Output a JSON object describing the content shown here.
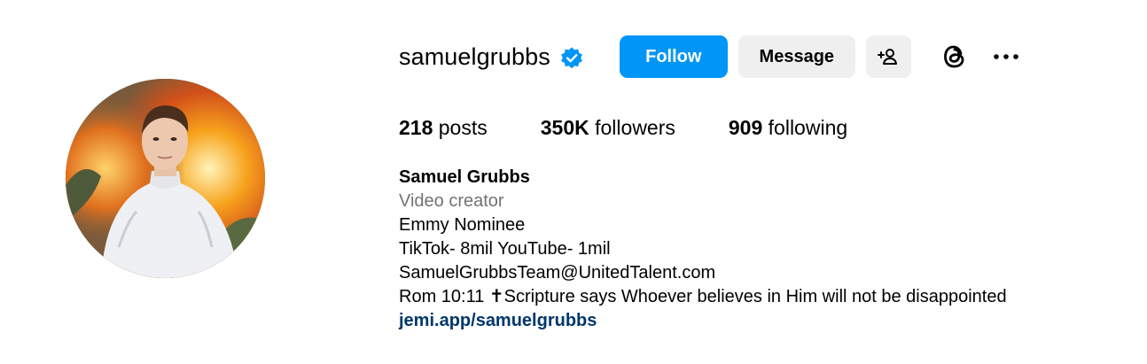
{
  "profile": {
    "username": "samuelgrubbs",
    "verified": true,
    "avatar_alt": "Samuel Grubbs profile picture"
  },
  "actions": {
    "follow_label": "Follow",
    "message_label": "Message",
    "suggest_icon": "person-add-icon",
    "threads_icon": "threads-icon",
    "more_icon": "more-options-icon"
  },
  "stats": {
    "posts_count": "218",
    "posts_label": "posts",
    "followers_count": "350K",
    "followers_label": "followers",
    "following_count": "909",
    "following_label": "following"
  },
  "bio": {
    "full_name": "Samuel Grubbs",
    "category": "Video creator",
    "lines": [
      "Emmy Nominee",
      "TikTok- 8mil YouTube- 1mil",
      "SamuelGrubbsTeam@UnitedTalent.com",
      "Rom 10:11 ✝Scripture says Whoever believes in Him will not be disappointed"
    ],
    "link": "jemi.app/samuelgrubbs"
  },
  "colors": {
    "accent": "#0095f6",
    "verified": "#0095f6",
    "secondary_text": "#737373",
    "link": "#00376b",
    "button_bg": "#efefef"
  }
}
